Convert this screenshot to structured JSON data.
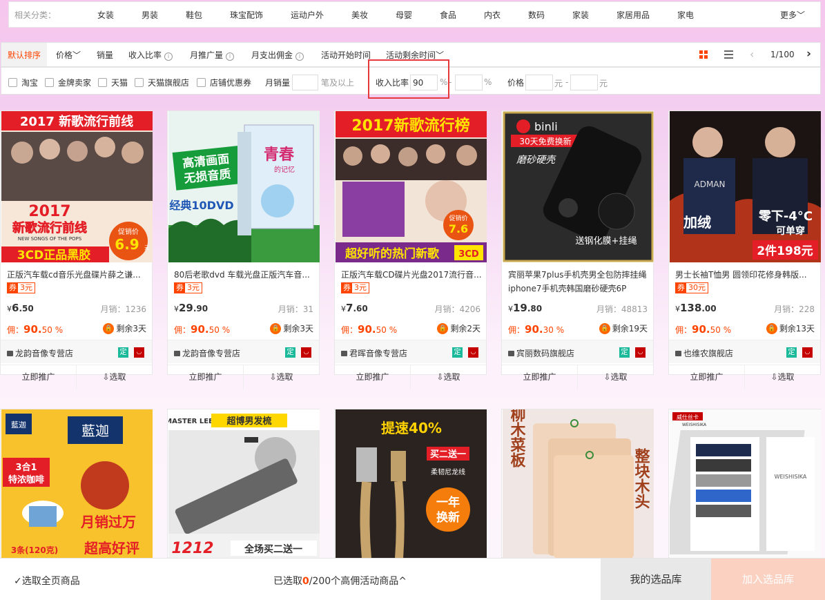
{
  "categories": {
    "label": "相关分类：",
    "items": [
      "女装",
      "男装",
      "鞋包",
      "珠宝配饰",
      "运动户外",
      "美妆",
      "母婴",
      "食品",
      "内衣",
      "数码",
      "家装",
      "家居用品",
      "家电"
    ],
    "more": "更多"
  },
  "sort": {
    "default": "默认排序",
    "price": "价格",
    "sales": "销量",
    "income_ratio": "收入比率",
    "monthly_promo": "月推广量",
    "monthly_commission": "月支出佣金",
    "start_time": "活动开始时间",
    "remaining_time": "活动剩余时间",
    "page": "1/100"
  },
  "filters": {
    "taobao": "淘宝",
    "gold_seller": "金牌卖家",
    "tmall": "天猫",
    "tmall_flagship": "天猫旗舰店",
    "shop_coupon": "店铺优惠券",
    "monthly_sales_label": "月销量",
    "monthly_sales_unit": "笔及以上",
    "income_label": "收入比率",
    "income_min": "90",
    "percent": "%",
    "dash": "-",
    "price_label": "价格",
    "yuan": "元"
  },
  "accent": "#ff4400",
  "products": [
    {
      "title": "正版汽车载cd音乐光盘碟片薛之谦...",
      "coupon_q": "券",
      "coupon": "3元",
      "yen": "¥",
      "price_int": "6",
      "price_dec": ".50",
      "sales": "月销：1236",
      "comm_label": "佣：",
      "comm_int": "90.",
      "comm_dec": "50",
      "comm_pct": "%",
      "remain": "剩余3天",
      "shop": "龙韵音像专营店",
      "promote": "立即推广",
      "pick": "选取",
      "ding": "定",
      "img_text": [
        "2017 新歌流行前线",
        "2017",
        "新歌流行前线",
        "NEW SONGS OF THE POPS",
        "促销价",
        "6.9",
        "元",
        "3CD正品黑胶"
      ]
    },
    {
      "title": "80后老歌dvd 车载光盘正版汽车音...",
      "coupon_q": "券",
      "coupon": "3元",
      "yen": "¥",
      "price_int": "29",
      "price_dec": ".90",
      "sales": "月销：31",
      "comm_label": "佣：",
      "comm_int": "90.",
      "comm_dec": "50",
      "comm_pct": "%",
      "remain": "剩余3天",
      "shop": "龙韵音像专营店",
      "promote": "立即推广",
      "pick": "选取",
      "ding": "定",
      "img_text": [
        "高清画面",
        "无损音质",
        "经典10DVD",
        "青春",
        "的记忆"
      ]
    },
    {
      "title": "正版汽车载CD碟片光盘2017流行音...",
      "coupon_q": "券",
      "coupon": "3元",
      "yen": "¥",
      "price_int": "7",
      "price_dec": ".60",
      "sales": "月销：4206",
      "comm_label": "佣：",
      "comm_int": "90.",
      "comm_dec": "50",
      "comm_pct": "%",
      "remain": "剩余2天",
      "shop": "君晖音像专营店",
      "promote": "立即推广",
      "pick": "选取",
      "ding": "定",
      "img_text": [
        "2017新歌流行榜",
        "促销价",
        "7.6",
        "超好听的热门新歌",
        "3CD"
      ]
    },
    {
      "title": "宾丽苹果7plus手机壳男全包防摔挂绳 iphone7手机壳韩国磨砂硬壳6P",
      "coupon_q": "",
      "coupon": "",
      "yen": "¥",
      "price_int": "19",
      "price_dec": ".80",
      "sales": "月销：48813",
      "comm_label": "佣：",
      "comm_int": "90.",
      "comm_dec": "30",
      "comm_pct": "%",
      "remain": "剩余19天",
      "shop": "宾丽数码旗舰店",
      "promote": "立即推广",
      "pick": "选取",
      "ding": "定",
      "img_text": [
        "binli",
        "30天免费换新",
        "磨砂硬壳",
        "送钢化膜+挂绳"
      ]
    },
    {
      "title": "男士长袖T恤男 圆领印花修身韩版...",
      "coupon_q": "券",
      "coupon": "30元",
      "yen": "¥",
      "price_int": "138",
      "price_dec": ".00",
      "sales": "月销：228",
      "comm_label": "佣：",
      "comm_int": "90.",
      "comm_dec": "50",
      "comm_pct": "%",
      "remain": "剩余13天",
      "shop": "也维农旗舰店",
      "promote": "立即推广",
      "pick": "选取",
      "ding": "定",
      "img_text": [
        "ADMAN",
        "加绒",
        "零下-4°C",
        "可单穿",
        "2件198元"
      ]
    }
  ],
  "row2_images": [
    {
      "img_text": [
        "藍迦",
        "藍迦",
        "3合1",
        "特浓咖啡",
        "月销过万",
        "3条(120克)",
        "超高好评"
      ]
    },
    {
      "img_text": [
        "MASTER LEE",
        "超博男发梳",
        "1212",
        "全场买二送一"
      ]
    },
    {
      "img_text": [
        "提速40%",
        "买二送一",
        "柔韧尼龙线",
        "一年",
        "换新"
      ]
    },
    {
      "img_text": [
        "柳木菜板",
        "整块木头"
      ]
    },
    {
      "img_text": [
        "威仕丝卡",
        "WEISHISIKA",
        "WEISHISIKA"
      ]
    }
  ],
  "footer": {
    "select_all": "选取全页商品",
    "selected_prefix": "已选取",
    "selected_count": "0",
    "selected_suffix": "/200个高佣活动商品",
    "my_library": "我的选品库",
    "add_library": "加入选品库"
  }
}
